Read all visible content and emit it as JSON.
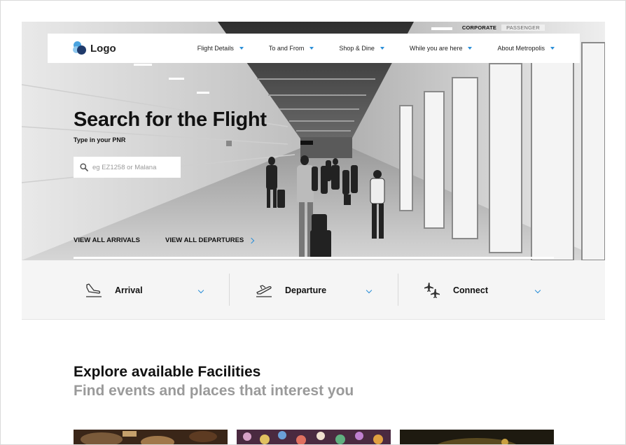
{
  "top_links": {
    "corporate": "CORPORATE",
    "passenger": "PASSENGER"
  },
  "logo": {
    "text": "Logo",
    "colors": [
      "#4aa3df",
      "#8fc8ef",
      "#1f3a6b"
    ]
  },
  "nav": {
    "items": [
      {
        "label": "Flight Details"
      },
      {
        "label": "To and From"
      },
      {
        "label": "Shop & Dine"
      },
      {
        "label": "While you are here"
      },
      {
        "label": "About Metropolis"
      }
    ]
  },
  "hero": {
    "title": "Search for the Flight",
    "subtitle": "Type in your PNR",
    "search_placeholder": "eg EZ1258 or Malana",
    "view_arrivals": "VIEW ALL ARRIVALS",
    "view_departures": "VIEW ALL DEPARTURES"
  },
  "flight_tabs": [
    {
      "label": "Arrival",
      "icon": "plane-landing-icon"
    },
    {
      "label": "Departure",
      "icon": "plane-takeoff-icon"
    },
    {
      "label": "Connect",
      "icon": "connecting-flights-icon"
    }
  ],
  "facilities": {
    "title": "Explore available Facilities",
    "subtitle": "Find events and places that interest you"
  },
  "colors": {
    "accent": "#2b8fd8",
    "muted_text": "#9a9a9a",
    "tab_bg": "#f5f5f5"
  }
}
